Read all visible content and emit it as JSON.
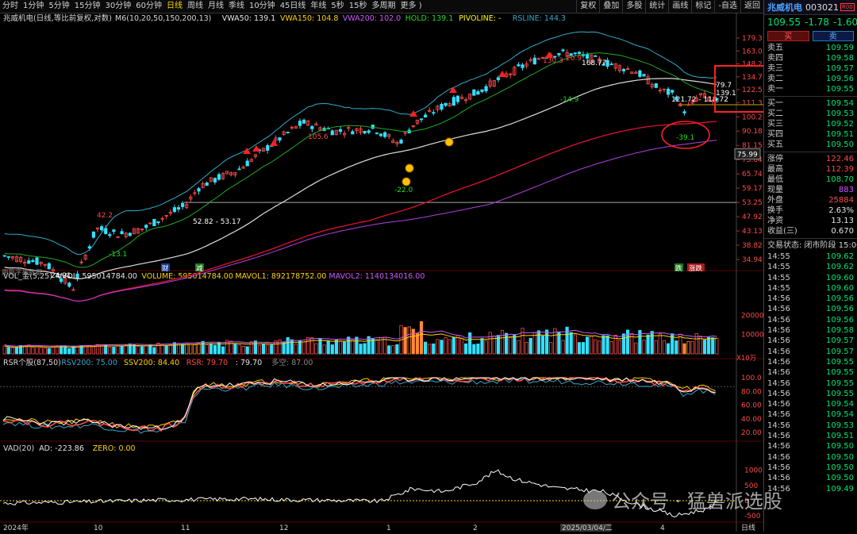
{
  "toolbar": {
    "periods": [
      "分时",
      "1分钟",
      "5分钟",
      "15分钟",
      "30分钟",
      "60分钟",
      "日线",
      "周线",
      "月线",
      "季线",
      "10分钟",
      "45日线",
      "年线",
      "5秒",
      "15秒",
      "多周期",
      "更多 )"
    ],
    "active_index": 6,
    "right": [
      "复权",
      "叠加",
      "多股",
      "统计",
      "画线",
      "标记",
      "-自选",
      "返回"
    ]
  },
  "main_legend": {
    "name": "兆威机电(日线,等比前复权,对数)",
    "items": [
      {
        "text": "M6(10,20,50,150,200,13)",
        "color": "#d8d8d8"
      },
      {
        "text": "VWA50: 139.1",
        "color": "#e6e6e6"
      },
      {
        "text": "VWA150: 104.8",
        "color": "#ffd400"
      },
      {
        "text": "VWA200: 102.0",
        "color": "#d05aff"
      },
      {
        "text": "HOLD: 139.1",
        "color": "#22dd22"
      },
      {
        "text": "PIVOLINE: -",
        "color": "#ffff00"
      },
      {
        "text": "RSLINE: 144.3",
        "color": "#33aacc"
      }
    ]
  },
  "price_axis": [
    "179.3",
    "163.0",
    "148.2",
    "134.7",
    "122.5",
    "111.3",
    "100.2",
    "90.18",
    "81.15",
    "73.04",
    "65.74",
    "59.17",
    "53.25",
    "47.92",
    "43.13",
    "38.82",
    "34.94"
  ],
  "current_price_tag": "75.99",
  "annotations": {
    "high_hi": "20.9",
    "high_top": "130.3",
    "peak": "168.77",
    "mid_high": "105.6",
    "low_22": "-22.0",
    "low_149": "-14.9",
    "low_131": "-13.1",
    "early_42": "42.2",
    "low_2421": "24.21",
    "range": "52.82 - 53.17",
    "right_high": "121.72 - 118.72",
    "right_79": "79.7",
    "right_1391": "139.1",
    "right_low": "-39.1",
    "bottom_left": "用距字果数据",
    "tag_cai": "财",
    "tag_jian": "减",
    "tag_die": "跌",
    "tag_zhang": "涨",
    "tag_tail": "跌"
  },
  "volume": {
    "legend": [
      {
        "text": "VOL_金(5,25)",
        "color": "#d8d8d8"
      },
      {
        "text": "VVOL: 595014784.00",
        "color": "#e6e6e6"
      },
      {
        "text": "VOLUME: 595014784.00",
        "color": "#ffd400"
      },
      {
        "text": "MAVOL1: 892178752.00",
        "color": "#ffd400"
      },
      {
        "text": "MAVOL2: 1140134016.00",
        "color": "#d05aff"
      }
    ],
    "axis": [
      "20000",
      "10000"
    ],
    "unit": "X10万"
  },
  "rsr": {
    "legend": [
      {
        "text": "RSR个股(87,50)",
        "color": "#d8d8d8"
      },
      {
        "text": "RSV200: 75.00",
        "color": "#33aacc"
      },
      {
        "text": "SSV200: 84.40",
        "color": "#ffd400"
      },
      {
        "text": "RSR: 79.70",
        "color": "#ff4a4a"
      },
      {
        "text": ": 79.70",
        "color": "#e6e6e6"
      },
      {
        "text": "多空: 87.00",
        "color": "#888"
      }
    ],
    "axis": [
      "100.0",
      "80.00",
      "60.00",
      "40.00",
      "20.00"
    ]
  },
  "vad": {
    "legend": [
      {
        "text": "VAD(20)",
        "color": "#d8d8d8"
      },
      {
        "text": "AD: -223.86",
        "color": "#e6e6e6"
      },
      {
        "text": "ZERO: 0.00",
        "color": "#ffd400"
      }
    ],
    "axis": [
      "1000",
      "500",
      "0",
      "-500"
    ]
  },
  "x_axis": [
    "2024年",
    "10",
    "11",
    "12",
    "1",
    "2",
    "2025/03/04/二",
    "4"
  ],
  "period_tag": "日线",
  "side": {
    "name": "兆威机电",
    "code": "003021",
    "rz": "R00",
    "price": "109.55",
    "change": "-1.78",
    "pct": "-1.60%",
    "buy_btn": "买",
    "sell_btn": "卖",
    "asks": [
      {
        "label": "卖五",
        "price": "109.59"
      },
      {
        "label": "卖四",
        "price": "109.58"
      },
      {
        "label": "卖三",
        "price": "109.57"
      },
      {
        "label": "卖二",
        "price": "109.56"
      },
      {
        "label": "卖一",
        "price": "109.55"
      }
    ],
    "bids": [
      {
        "label": "买一",
        "price": "109.54"
      },
      {
        "label": "买二",
        "price": "109.53"
      },
      {
        "label": "买三",
        "price": "109.52"
      },
      {
        "label": "买四",
        "price": "109.51"
      },
      {
        "label": "买五",
        "price": "109.50"
      }
    ],
    "stats": [
      {
        "label": "涨停",
        "value": "122.46",
        "cls": "red"
      },
      {
        "label": "最高",
        "value": "112.39",
        "cls": "red"
      },
      {
        "label": "最低",
        "value": "108.70",
        "cls": "green"
      },
      {
        "label": "现量",
        "value": "883",
        "cls": "purple"
      },
      {
        "label": "外盘",
        "value": "25884",
        "cls": "red"
      },
      {
        "label": "换手",
        "value": "2.63%",
        "cls": "white"
      },
      {
        "label": "净资",
        "value": "13.13",
        "cls": "white"
      },
      {
        "label": "收益(三)",
        "value": "0.670",
        "cls": "white"
      }
    ],
    "status": "交易状态: 闭市阶段 15:00",
    "ticks": [
      {
        "t": "14:55",
        "p": "109.62"
      },
      {
        "t": "14:55",
        "p": "109.62"
      },
      {
        "t": "14:55",
        "p": "109.60"
      },
      {
        "t": "14:55",
        "p": "109.60"
      },
      {
        "t": "14:56",
        "p": "109.56"
      },
      {
        "t": "14:56",
        "p": "109.56"
      },
      {
        "t": "14:56",
        "p": "109.56"
      },
      {
        "t": "14:56",
        "p": "109.58"
      },
      {
        "t": "14:56",
        "p": "109.57"
      },
      {
        "t": "14:56",
        "p": "109.57"
      },
      {
        "t": "14:56",
        "p": "109.55"
      },
      {
        "t": "14:56",
        "p": "109.55"
      },
      {
        "t": "14:56",
        "p": "109.55"
      },
      {
        "t": "14:56",
        "p": "109.55"
      },
      {
        "t": "14:56",
        "p": "109.54"
      },
      {
        "t": "14:56",
        "p": "109.54"
      },
      {
        "t": "14:56",
        "p": "109.53"
      },
      {
        "t": "14:56",
        "p": "109.51"
      },
      {
        "t": "14:56",
        "p": "109.50"
      },
      {
        "t": "14:56",
        "p": "109.50"
      },
      {
        "t": "14:56",
        "p": "109.50"
      },
      {
        "t": "14:56",
        "p": "109.50"
      },
      {
        "t": "14:56",
        "p": "109.49"
      }
    ]
  },
  "watermark": "公众号 · 猛兽派选股",
  "colors": {
    "up": "#ff4a4a",
    "down": "#33e0ff",
    "ma": "#ffd400",
    "vwa200": "#dd1133",
    "rsline": "#33aacc"
  }
}
